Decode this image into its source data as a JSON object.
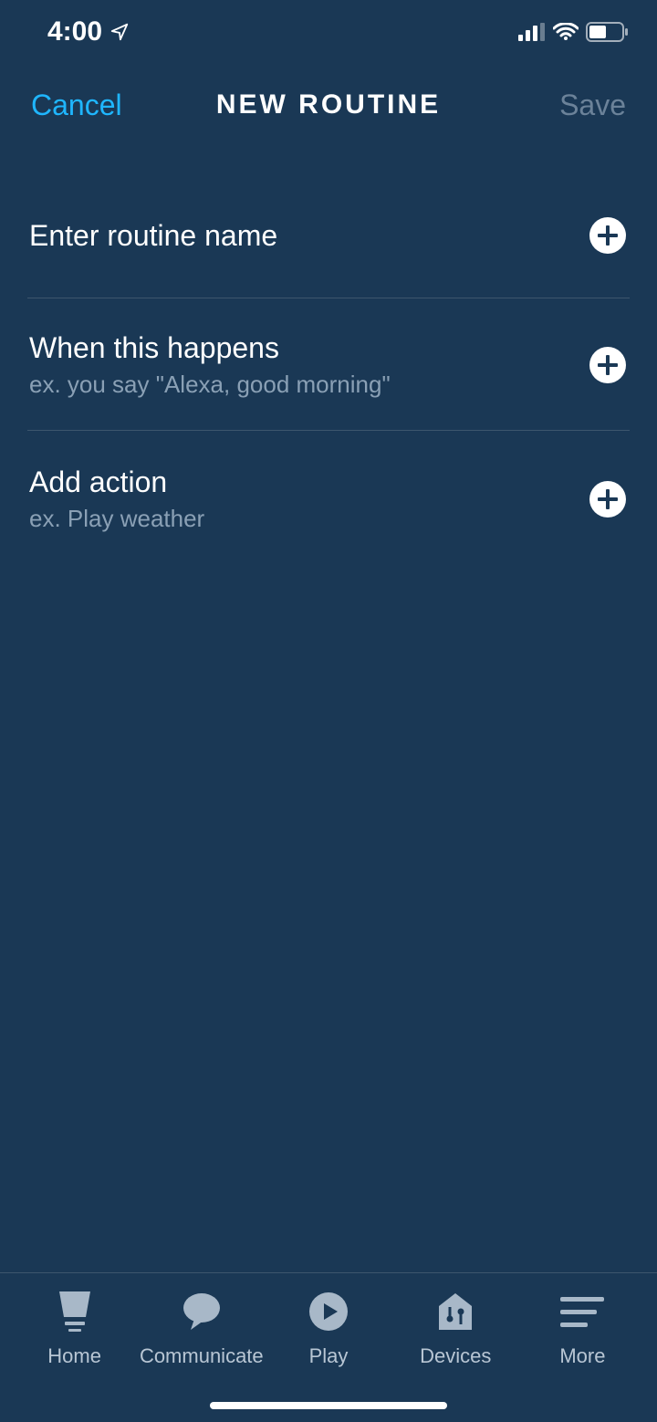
{
  "status": {
    "time": "4:00"
  },
  "nav": {
    "cancel": "Cancel",
    "title": "NEW ROUTINE",
    "save": "Save"
  },
  "rows": {
    "name": {
      "title": "Enter routine name"
    },
    "trigger": {
      "title": "When this happens",
      "subtitle": "ex. you say \"Alexa, good morning\""
    },
    "action": {
      "title": "Add action",
      "subtitle": "ex. Play weather"
    }
  },
  "tabs": {
    "home": "Home",
    "communicate": "Communicate",
    "play": "Play",
    "devices": "Devices",
    "more": "More"
  }
}
